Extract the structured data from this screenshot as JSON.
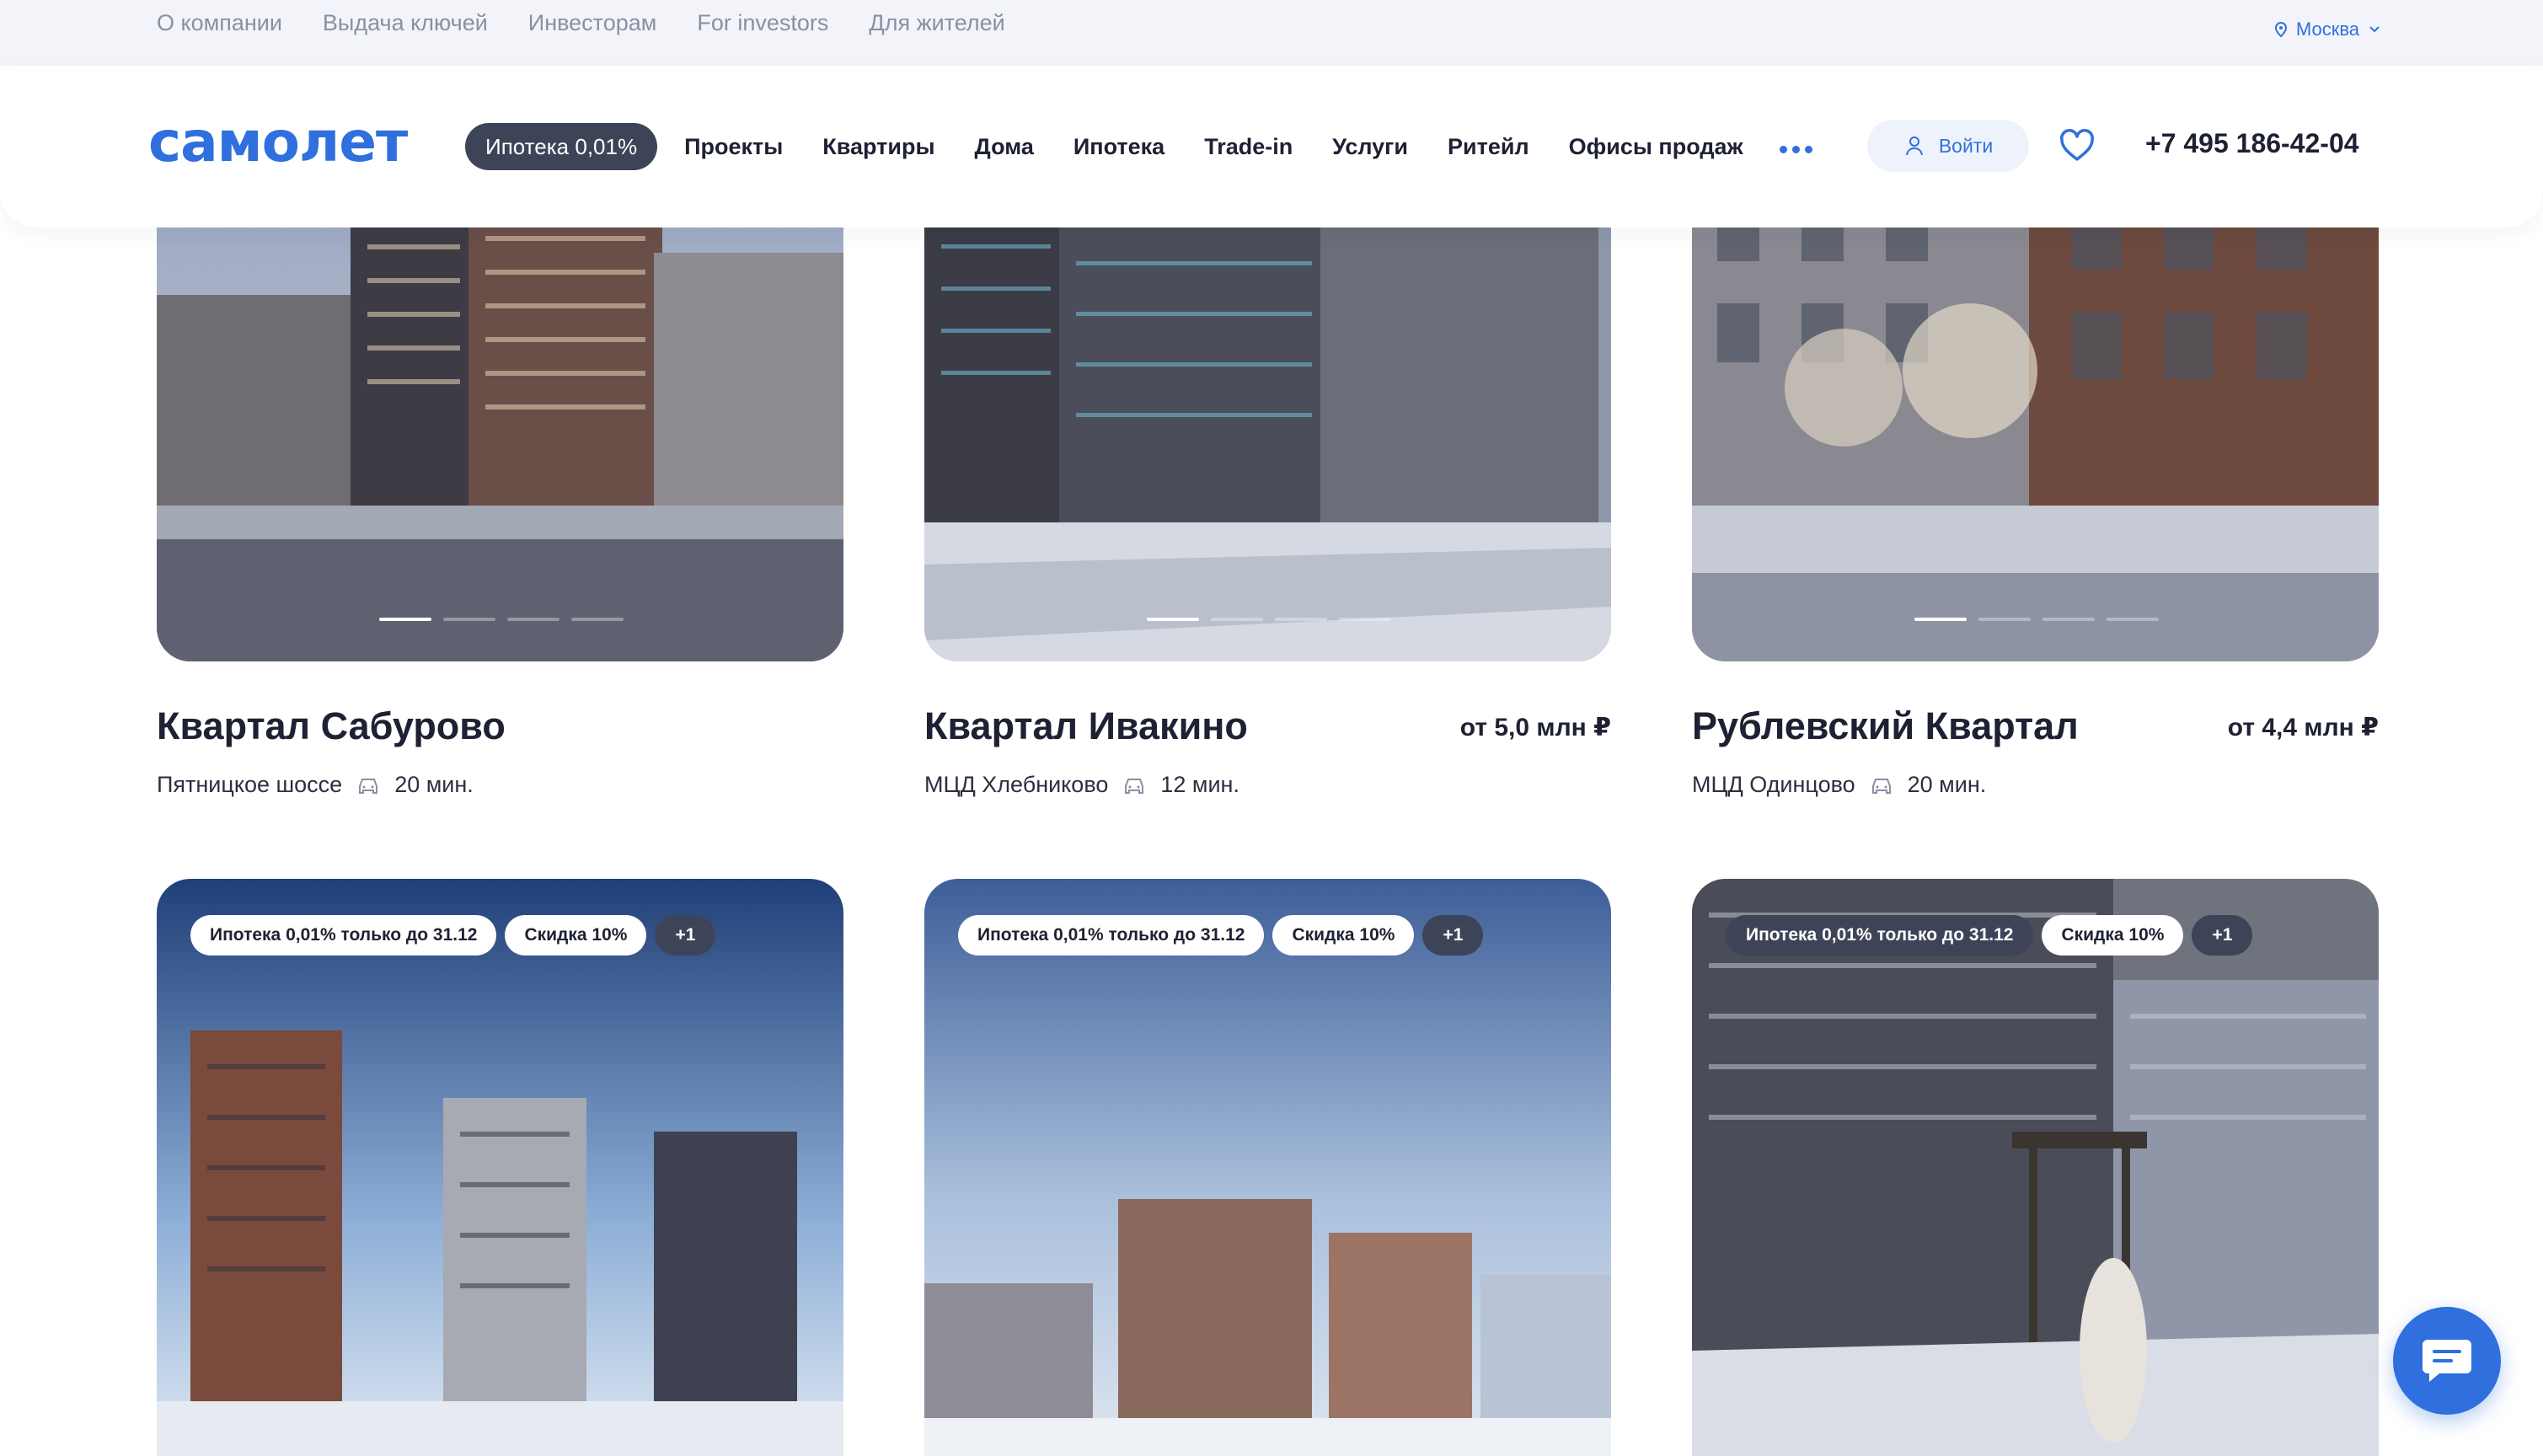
{
  "topbar": {
    "links": [
      "О компании",
      "Выдача ключей",
      "Инвесторам",
      "For investors",
      "Для жителей"
    ],
    "city": "Москва"
  },
  "header": {
    "logo": "самолет",
    "promo": "Ипотека 0,01%",
    "nav": [
      "Проекты",
      "Квартиры",
      "Дома",
      "Ипотека",
      "Trade-in",
      "Услуги",
      "Ритейл",
      "Офисы продаж"
    ],
    "login": "Войти",
    "phone": "+7 495 186-42-04"
  },
  "projects": [
    {
      "title": "Квартал Сабурово",
      "price": "",
      "location": "Пятницкое шоссе",
      "commute": "20 мин."
    },
    {
      "title": "Квартал Ивакино",
      "price": "от 5,0 млн ₽",
      "location": "МЦД Хлебниково",
      "commute": "12 мин."
    },
    {
      "title": "Рублевский Квартал",
      "price": "от 4,4 млн ₽",
      "location": "МЦД Одинцово",
      "commute": "20 мин."
    }
  ],
  "row2_badges": {
    "mortgage": "Ипотека 0,01% только до 31.12",
    "discount": "Скидка 10%",
    "more": "+1"
  },
  "colors": {
    "brand": "#2f6fde",
    "dark_pill": "#3e4458",
    "topbar_bg": "#f3f4f9"
  }
}
